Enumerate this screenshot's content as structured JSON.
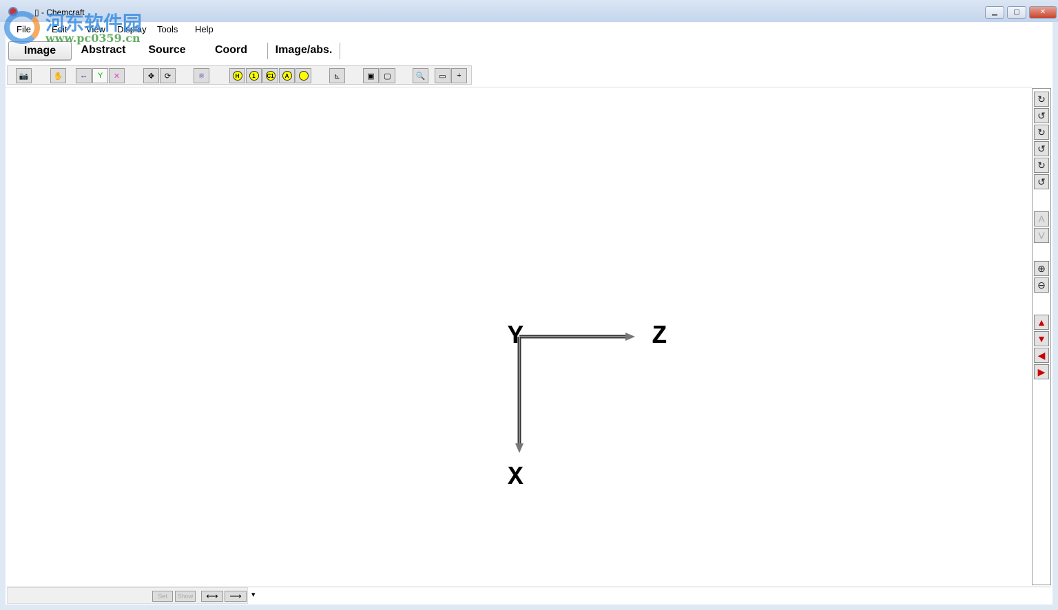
{
  "window": {
    "title": "▯ - Chemcraft",
    "minimize": "▁",
    "maximize": "▢",
    "close": "✕"
  },
  "watermark": {
    "text": "河东软件园",
    "url": "www.pc0359.cn"
  },
  "menu": [
    "File",
    "Edit",
    "View",
    "Display",
    "Tools",
    "Help"
  ],
  "tabs": [
    {
      "label": "Image",
      "active": true
    },
    {
      "label": "Abstract"
    },
    {
      "label": "Source"
    },
    {
      "label": "Coord"
    },
    {
      "label": "Image/abs."
    }
  ],
  "toolbar": {
    "atom_labels": [
      "H",
      "1",
      "C1",
      "A",
      ""
    ]
  },
  "axes": {
    "y": "Y",
    "z": "Z",
    "x": "X"
  },
  "rightbar": {
    "rotate": [
      "↻",
      "↺",
      "↻",
      "↺",
      "↻",
      "↺"
    ],
    "flip": [
      "A",
      "V"
    ],
    "zoom": [
      "⊕",
      "⊖"
    ],
    "move": [
      "▲",
      "▼",
      "◀",
      "▶"
    ]
  },
  "status": {
    "set": "Set",
    "show": "Show",
    "dropdown": "▾"
  }
}
